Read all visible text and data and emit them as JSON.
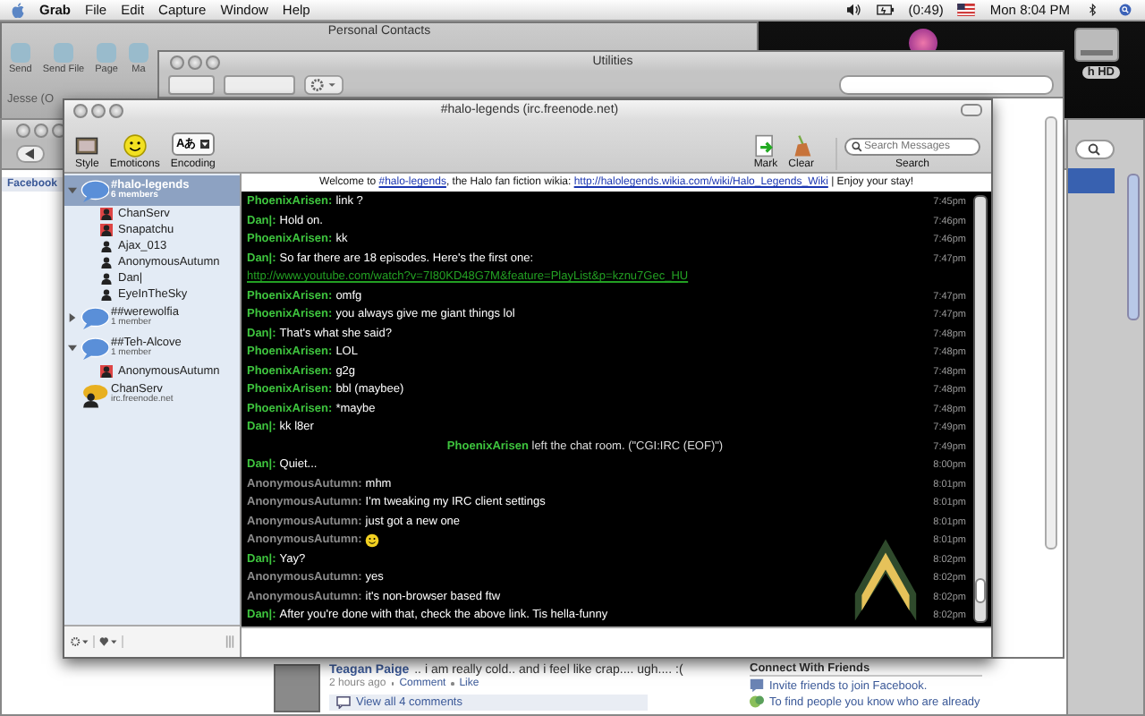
{
  "menu_bar": {
    "app": "Grab",
    "menus": [
      "File",
      "Edit",
      "Capture",
      "Window",
      "Help"
    ],
    "battery": "(0:49)",
    "clock": "Mon 8:04 PM"
  },
  "desktop": {
    "disk_label": "h HD"
  },
  "contacts_window": {
    "title": "Personal Contacts",
    "toolbar": [
      "Send",
      "Send File",
      "Page",
      "Ma"
    ],
    "contact": "Jesse (O"
  },
  "utilities_window": {
    "title": "Utilities"
  },
  "browser": {
    "tab": "Facebook",
    "post": {
      "author": "Teagan Paige",
      "text": ".. i am really cold.. and i feel like crap.... ugh.... :(",
      "time": "2 hours ago",
      "actions": [
        "Comment",
        "Like"
      ],
      "comments": "View all 4 comments"
    },
    "side": {
      "heading": "Connect With Friends",
      "links": [
        "Invite friends to join Facebook.",
        "To find people you know who are already"
      ]
    }
  },
  "chat_window": {
    "title": "#halo-legends (irc.freenode.net)",
    "toolbar": [
      {
        "label": "Style",
        "kind": "style"
      },
      {
        "label": "Emoticons",
        "kind": "emoticons"
      },
      {
        "label": "Encoding",
        "kind": "encoding",
        "value": "Aあ"
      }
    ],
    "actions": [
      {
        "label": "Mark",
        "kind": "mark"
      },
      {
        "label": "Clear",
        "kind": "clear"
      }
    ],
    "search": {
      "placeholder": "Search Messages",
      "label": "Search"
    },
    "contacts": [
      {
        "kind": "channel",
        "name": "#halo-legends",
        "members": "6 members",
        "expanded": true,
        "selected": true,
        "children": [
          {
            "kind": "user",
            "name": "ChanServ",
            "op": true
          },
          {
            "kind": "user",
            "name": "Snapatchu",
            "op": true
          },
          {
            "kind": "user",
            "name": "Ajax_013",
            "op": false
          },
          {
            "kind": "user",
            "name": "AnonymousAutumn",
            "op": false
          },
          {
            "kind": "user",
            "name": "Dan|",
            "op": false
          },
          {
            "kind": "user",
            "name": "EyeInTheSky",
            "op": false
          }
        ]
      },
      {
        "kind": "channel",
        "name": "##werewolfia",
        "members": "1 member",
        "expanded": false,
        "selected": false
      },
      {
        "kind": "channel",
        "name": "##Teh-Alcove",
        "members": "1 member",
        "expanded": true,
        "selected": false,
        "children": [
          {
            "kind": "user",
            "name": "AnonymousAutumn",
            "op": true
          }
        ]
      },
      {
        "kind": "private",
        "name": "ChanServ",
        "server": "irc.freenode.net",
        "selected": false
      }
    ],
    "topic": [
      {
        "text": "Welcome to "
      },
      {
        "link": "#halo-legends"
      },
      {
        "text": ", the Halo fan fiction wikia: "
      },
      {
        "link": "http://halolegends.wikia.com/wiki/Halo_Legends_Wiki"
      },
      {
        "text": " | Enjoy your stay!"
      }
    ],
    "messages": [
      {
        "kind": "message",
        "nick": "PhoenixArisen:",
        "color": "#3ec43e",
        "text": "link ?",
        "time": "7:45pm"
      },
      {
        "kind": "message",
        "nick": "Dan|:",
        "color": "#3ec43e",
        "text": "Hold on.",
        "time": "7:46pm"
      },
      {
        "kind": "message",
        "nick": "PhoenixArisen:",
        "color": "#3ec43e",
        "text": "kk",
        "time": "7:46pm"
      },
      {
        "kind": "message",
        "nick": "Dan|:",
        "color": "#3ec43e",
        "text": "So far there are 18 episodes. Here's the first one:",
        "link": "http://www.youtube.com/watch?v=7I80KD48G7M&feature=PlayList&p=kznu7Gec_HU",
        "time": "7:47pm"
      },
      {
        "kind": "message",
        "nick": "PhoenixArisen:",
        "color": "#3ec43e",
        "text": "omfg",
        "time": "7:47pm"
      },
      {
        "kind": "message",
        "nick": "PhoenixArisen:",
        "color": "#3ec43e",
        "text": "you always give me giant things lol",
        "time": "7:47pm"
      },
      {
        "kind": "message",
        "nick": "Dan|:",
        "color": "#3ec43e",
        "text": "That's what she said?",
        "time": "7:48pm"
      },
      {
        "kind": "message",
        "nick": "PhoenixArisen:",
        "color": "#3ec43e",
        "text": "LOL",
        "time": "7:48pm"
      },
      {
        "kind": "message",
        "nick": "PhoenixArisen:",
        "color": "#3ec43e",
        "text": "g2g",
        "time": "7:48pm"
      },
      {
        "kind": "message",
        "nick": "PhoenixArisen:",
        "color": "#3ec43e",
        "text": "bbl (maybee)",
        "time": "7:48pm"
      },
      {
        "kind": "message",
        "nick": "PhoenixArisen:",
        "color": "#3ec43e",
        "text": "*maybe",
        "time": "7:48pm"
      },
      {
        "kind": "message",
        "nick": "Dan|:",
        "color": "#3ec43e",
        "text": "kk l8er",
        "time": "7:49pm"
      },
      {
        "kind": "event",
        "nick": "PhoenixArisen",
        "color": "#3ec43e",
        "text": "left the chat room. (\"CGI:IRC (EOF)\")",
        "time": "7:49pm"
      },
      {
        "kind": "message",
        "nick": "Dan|:",
        "color": "#3ec43e",
        "text": "Quiet...",
        "time": "8:00pm"
      },
      {
        "kind": "message",
        "nick": "AnonymousAutumn:",
        "color": "#8c8c8c",
        "text": "mhm",
        "time": "8:01pm"
      },
      {
        "kind": "message",
        "nick": "AnonymousAutumn:",
        "color": "#8c8c8c",
        "text": "I'm tweaking my IRC client settings",
        "time": "8:01pm"
      },
      {
        "kind": "message",
        "nick": "AnonymousAutumn:",
        "color": "#8c8c8c",
        "text": "just got a new one",
        "time": "8:01pm"
      },
      {
        "kind": "emoticon",
        "nick": "AnonymousAutumn:",
        "color": "#8c8c8c",
        "time": "8:01pm"
      },
      {
        "kind": "message",
        "nick": "Dan|:",
        "color": "#3ec43e",
        "text": "Yay?",
        "time": "8:02pm"
      },
      {
        "kind": "message",
        "nick": "AnonymousAutumn:",
        "color": "#8c8c8c",
        "text": "yes",
        "time": "8:02pm"
      },
      {
        "kind": "message",
        "nick": "AnonymousAutumn:",
        "color": "#8c8c8c",
        "text": "it's non-browser based ftw",
        "time": "8:02pm"
      },
      {
        "kind": "message",
        "nick": "Dan|:",
        "color": "#3ec43e",
        "text": "After you're done with that, check the above link. Tis hella-funny",
        "time": "8:02pm"
      }
    ]
  }
}
